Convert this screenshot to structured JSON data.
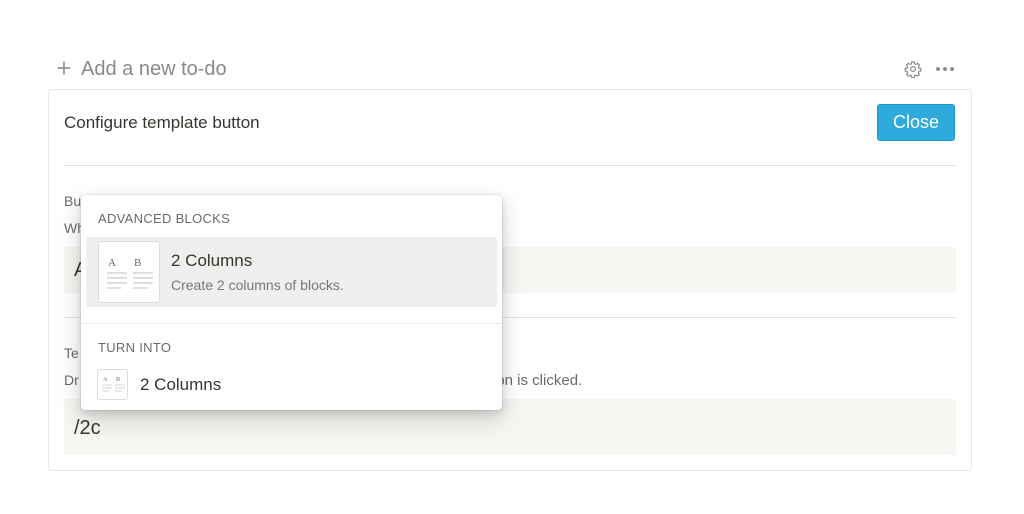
{
  "add_todo": {
    "label": "Add a new to-do"
  },
  "toolbar": {
    "settings_icon": "gear-icon",
    "more_icon": "more-dots-icon"
  },
  "panel": {
    "title": "Configure template button",
    "close_label": "Close",
    "button_name": {
      "label": "Bu",
      "help": "Wh",
      "value": "A"
    },
    "template": {
      "label": "Te",
      "help_start": "Dr",
      "help_end": "tton is clicked.",
      "value": "/2c"
    }
  },
  "menu": {
    "sections": [
      {
        "title": "ADVANCED BLOCKS",
        "items": [
          {
            "title": "2 Columns",
            "description": "Create 2 columns of blocks.",
            "thumb_a": "A",
            "thumb_b": "B",
            "icon": "two-columns-icon",
            "highlighted": true
          }
        ]
      },
      {
        "title": "TURN INTO",
        "items": [
          {
            "title": "2 Columns",
            "thumb_a": "A",
            "thumb_b": "B",
            "icon": "two-columns-icon"
          }
        ]
      }
    ]
  },
  "colors": {
    "accent": "#2eaadc",
    "field_bg": "#f7f6f3",
    "hover_bg": "#efefee",
    "text": "#37352f",
    "muted": "#787774"
  }
}
